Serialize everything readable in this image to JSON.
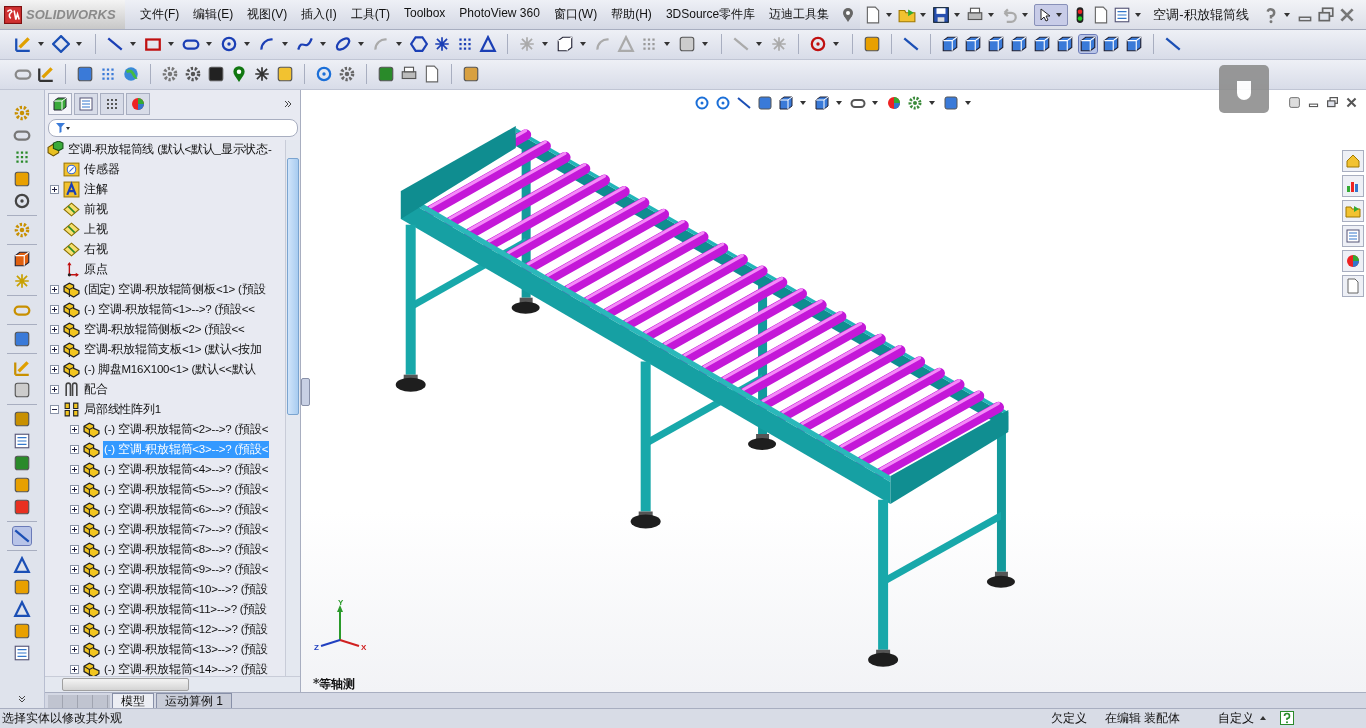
{
  "app": {
    "logo": "SOLIDWORKS"
  },
  "menu": [
    "文件(F)",
    "编辑(E)",
    "视图(V)",
    "插入(I)",
    "工具(T)",
    "Toolbox",
    "PhotoView 360",
    "窗口(W)",
    "帮助(H)",
    "3DSource零件库",
    "迈迪工具集"
  ],
  "document_title": "空调-积放辊筒线",
  "tree": {
    "label": "空调-积放辊筒线  (默认<默认_显示状态-",
    "kind": "assembly",
    "selected": false,
    "children": [
      {
        "label": "传感器",
        "kind": "sensor",
        "selected": false
      },
      {
        "label": "注解",
        "kind": "annotation",
        "expanded": false,
        "selected": false
      },
      {
        "label": "前视",
        "kind": "plane",
        "selected": false
      },
      {
        "label": "上视",
        "kind": "plane",
        "selected": false
      },
      {
        "label": "右视",
        "kind": "plane",
        "selected": false
      },
      {
        "label": "原点",
        "kind": "origin",
        "selected": false
      },
      {
        "label": "(固定) 空调-积放辊筒侧板<1> (預設",
        "kind": "part",
        "expanded": false,
        "selected": false
      },
      {
        "label": "(-) 空调-积放辊筒<1>-->? (預設<<",
        "kind": "part",
        "expanded": false,
        "selected": false
      },
      {
        "label": "空调-积放辊筒侧板<2> (預設<<",
        "kind": "part",
        "expanded": false,
        "selected": false
      },
      {
        "label": "空调-积放辊筒支板<1> (默认<按加",
        "kind": "part",
        "expanded": false,
        "selected": false
      },
      {
        "label": "(-) 脚盘M16X100<1> (默认<<默认",
        "kind": "part",
        "expanded": false,
        "selected": false
      },
      {
        "label": "配合",
        "kind": "mates",
        "expanded": false,
        "selected": false
      },
      {
        "label": "局部线性阵列1",
        "kind": "pattern",
        "expanded": true,
        "selected": false,
        "children": [
          {
            "label": "(-) 空调-积放辊筒<2>-->? (預設<",
            "kind": "part",
            "expanded": false,
            "selected": false
          },
          {
            "label": "(-) 空调-积放辊筒<3>-->? (預設<",
            "kind": "part",
            "expanded": false,
            "selected": true
          },
          {
            "label": "(-) 空调-积放辊筒<4>-->? (預設<",
            "kind": "part",
            "expanded": false,
            "selected": false
          },
          {
            "label": "(-) 空调-积放辊筒<5>-->? (預設<",
            "kind": "part",
            "expanded": false,
            "selected": false
          },
          {
            "label": "(-) 空调-积放辊筒<6>-->? (預設<",
            "kind": "part",
            "expanded": false,
            "selected": false
          },
          {
            "label": "(-) 空调-积放辊筒<7>-->? (預設<",
            "kind": "part",
            "expanded": false,
            "selected": false
          },
          {
            "label": "(-) 空调-积放辊筒<8>-->? (預設<",
            "kind": "part",
            "expanded": false,
            "selected": false
          },
          {
            "label": "(-) 空调-积放辊筒<9>-->? (預設<",
            "kind": "part",
            "expanded": false,
            "selected": false
          },
          {
            "label": "(-) 空调-积放辊筒<10>-->? (預設",
            "kind": "part",
            "expanded": false,
            "selected": false
          },
          {
            "label": "(-) 空调-积放辊筒<11>-->? (預設",
            "kind": "part",
            "expanded": false,
            "selected": false
          },
          {
            "label": "(-) 空调-积放辊筒<12>-->? (預設",
            "kind": "part",
            "expanded": false,
            "selected": false
          },
          {
            "label": "(-) 空调-积放辊筒<13>-->? (預設",
            "kind": "part",
            "expanded": false,
            "selected": false
          },
          {
            "label": "(-) 空调-积放辊筒<14>-->? (預設",
            "kind": "part",
            "expanded": false,
            "selected": false
          }
        ]
      }
    ]
  },
  "viewport": {
    "view_name": "*等轴测",
    "triad": {
      "x": "X",
      "y": "Y",
      "z": "Z"
    }
  },
  "bottom_tabs": [
    {
      "label": "模型",
      "selected": true
    },
    {
      "label": "运动算例 1",
      "selected": false
    }
  ],
  "status_bar": {
    "message": "选择实体以修改其外观",
    "state": "欠定义",
    "mode": "在编辑 装配体",
    "units": "自定义"
  }
}
